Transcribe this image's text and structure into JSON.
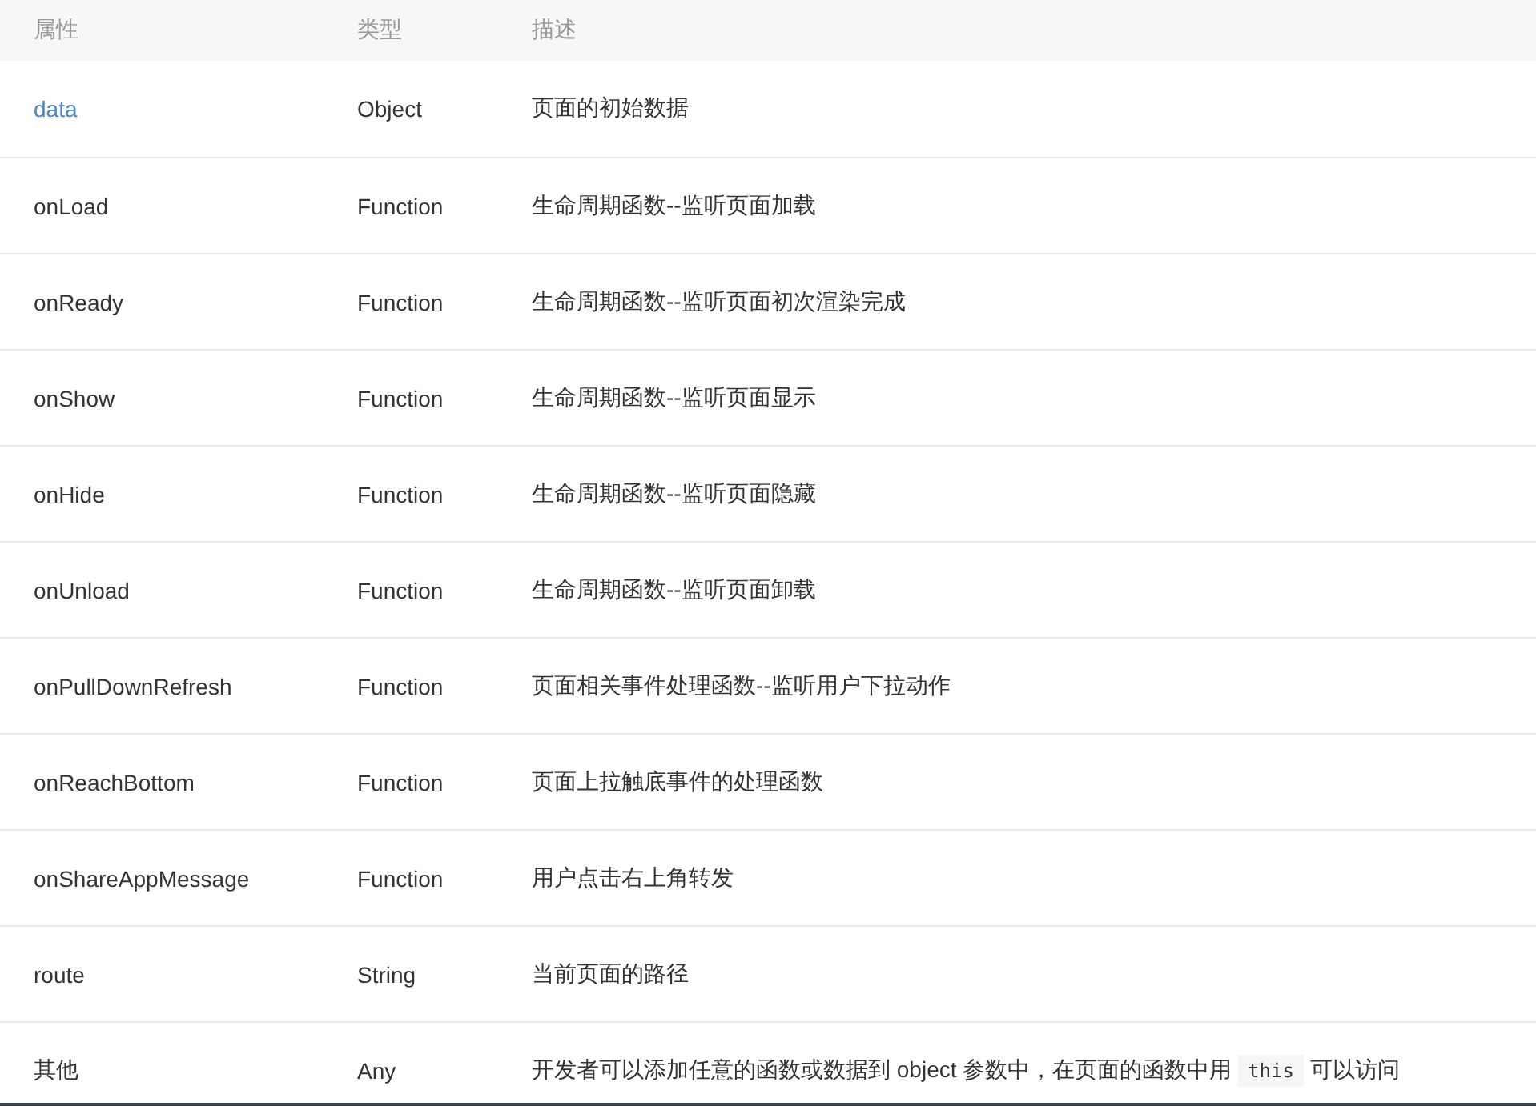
{
  "table": {
    "columns": [
      "属性",
      "类型",
      "描述"
    ],
    "rows": [
      {
        "name": "data",
        "kind": "link",
        "type": "Object",
        "description": [
          {
            "kind": "text",
            "text": "页面的初始数据"
          }
        ]
      },
      {
        "name": "onLoad",
        "kind": "text",
        "type": "Function",
        "description": [
          {
            "kind": "text",
            "text": "生命周期函数--监听页面加载"
          }
        ]
      },
      {
        "name": "onReady",
        "kind": "text",
        "type": "Function",
        "description": [
          {
            "kind": "text",
            "text": "生命周期函数--监听页面初次渲染完成"
          }
        ]
      },
      {
        "name": "onShow",
        "kind": "text",
        "type": "Function",
        "description": [
          {
            "kind": "text",
            "text": "生命周期函数--监听页面显示"
          }
        ]
      },
      {
        "name": "onHide",
        "kind": "text",
        "type": "Function",
        "description": [
          {
            "kind": "text",
            "text": "生命周期函数--监听页面隐藏"
          }
        ]
      },
      {
        "name": "onUnload",
        "kind": "text",
        "type": "Function",
        "description": [
          {
            "kind": "text",
            "text": "生命周期函数--监听页面卸载"
          }
        ]
      },
      {
        "name": "onPullDownRefresh",
        "kind": "text",
        "type": "Function",
        "description": [
          {
            "kind": "text",
            "text": "页面相关事件处理函数--监听用户下拉动作"
          }
        ]
      },
      {
        "name": "onReachBottom",
        "kind": "text",
        "type": "Function",
        "description": [
          {
            "kind": "text",
            "text": "页面上拉触底事件的处理函数"
          }
        ]
      },
      {
        "name": "onShareAppMessage",
        "kind": "text",
        "type": "Function",
        "description": [
          {
            "kind": "text",
            "text": "用户点击右上角转发"
          }
        ]
      },
      {
        "name": "route",
        "kind": "text",
        "type": "String",
        "description": [
          {
            "kind": "text",
            "text": "当前页面的路径"
          }
        ]
      },
      {
        "name": "其他",
        "kind": "text",
        "type": "Any",
        "description": [
          {
            "kind": "text",
            "text": "开发者可以添加任意的函数或数据到 object 参数中，在页面的函数中用 "
          },
          {
            "kind": "code",
            "text": "this"
          },
          {
            "kind": "text",
            "text": " 可以访问"
          }
        ]
      }
    ]
  }
}
